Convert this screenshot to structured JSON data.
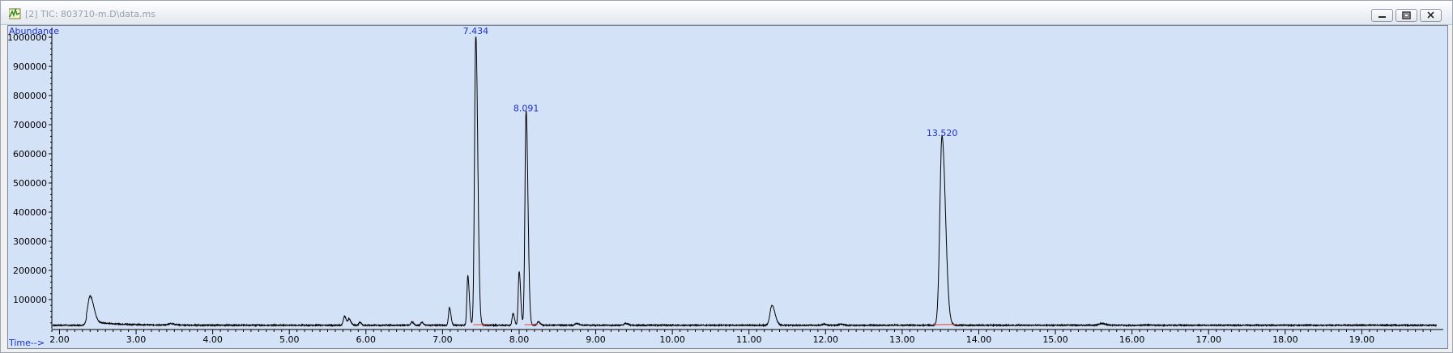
{
  "window": {
    "title": "[2] TIC: 803710-m.D\\data.ms",
    "icons": {
      "app": "chromatogram-app-icon",
      "minimize": "minimize-icon",
      "restore": "restore-icon",
      "close": "close-icon"
    }
  },
  "chart_data": {
    "type": "line",
    "ylabel": "Abundance",
    "xlabel": "Time-->",
    "xlim": [
      1.9,
      20.0
    ],
    "ylim": [
      0,
      1000000
    ],
    "x_ticks": [
      "2.00",
      "3.00",
      "4.00",
      "5.00",
      "6.00",
      "7.00",
      "8.00",
      "9.00",
      "10.00",
      "11.00",
      "12.00",
      "13.00",
      "14.00",
      "15.00",
      "16.00",
      "17.00",
      "18.00",
      "19.00"
    ],
    "y_ticks": [
      "100000",
      "200000",
      "300000",
      "400000",
      "500000",
      "600000",
      "700000",
      "800000",
      "900000",
      "1000000"
    ],
    "baseline": 12000,
    "series": [
      {
        "peaks": [
          {
            "rt": 2.4,
            "height": 88000,
            "width": 0.03
          },
          {
            "rt": 3.45,
            "height": 5000,
            "width": 0.03
          },
          {
            "rt": 5.72,
            "height": 30000,
            "width": 0.015
          },
          {
            "rt": 5.78,
            "height": 20000,
            "width": 0.015
          },
          {
            "rt": 5.92,
            "height": 10000,
            "width": 0.012
          },
          {
            "rt": 6.6,
            "height": 12000,
            "width": 0.012
          },
          {
            "rt": 6.73,
            "height": 10000,
            "width": 0.012
          },
          {
            "rt": 7.09,
            "height": 60000,
            "width": 0.012
          },
          {
            "rt": 7.33,
            "height": 170000,
            "width": 0.012
          },
          {
            "rt": 7.434,
            "height": 1000000,
            "width": 0.016
          },
          {
            "rt": 7.92,
            "height": 40000,
            "width": 0.012
          },
          {
            "rt": 8.0,
            "height": 185000,
            "width": 0.012
          },
          {
            "rt": 8.091,
            "height": 735000,
            "width": 0.015
          },
          {
            "rt": 8.25,
            "height": 12000,
            "width": 0.015
          },
          {
            "rt": 8.75,
            "height": 6000,
            "width": 0.02
          },
          {
            "rt": 9.39,
            "height": 6000,
            "width": 0.02
          },
          {
            "rt": 11.3,
            "height": 68000,
            "width": 0.025
          },
          {
            "rt": 11.98,
            "height": 4000,
            "width": 0.02
          },
          {
            "rt": 12.2,
            "height": 4000,
            "width": 0.02
          },
          {
            "rt": 13.52,
            "height": 650000,
            "width": 0.028
          },
          {
            "rt": 15.6,
            "height": 6000,
            "width": 0.03
          }
        ]
      }
    ],
    "annotations": [
      {
        "label": "7.434",
        "rt": 7.434,
        "y": 1000000
      },
      {
        "label": "8.091",
        "rt": 8.091,
        "y": 735000
      },
      {
        "label": "13.520",
        "rt": 13.52,
        "y": 650000
      }
    ],
    "integration_baselines": [
      [
        7.4,
        7.6
      ],
      [
        8.07,
        8.25
      ],
      [
        13.4,
        13.72
      ]
    ],
    "colors": {
      "trace": "#000000",
      "labels": "#1c2fc9",
      "integration": "#e0453c",
      "background": "#d4e2f8"
    }
  }
}
